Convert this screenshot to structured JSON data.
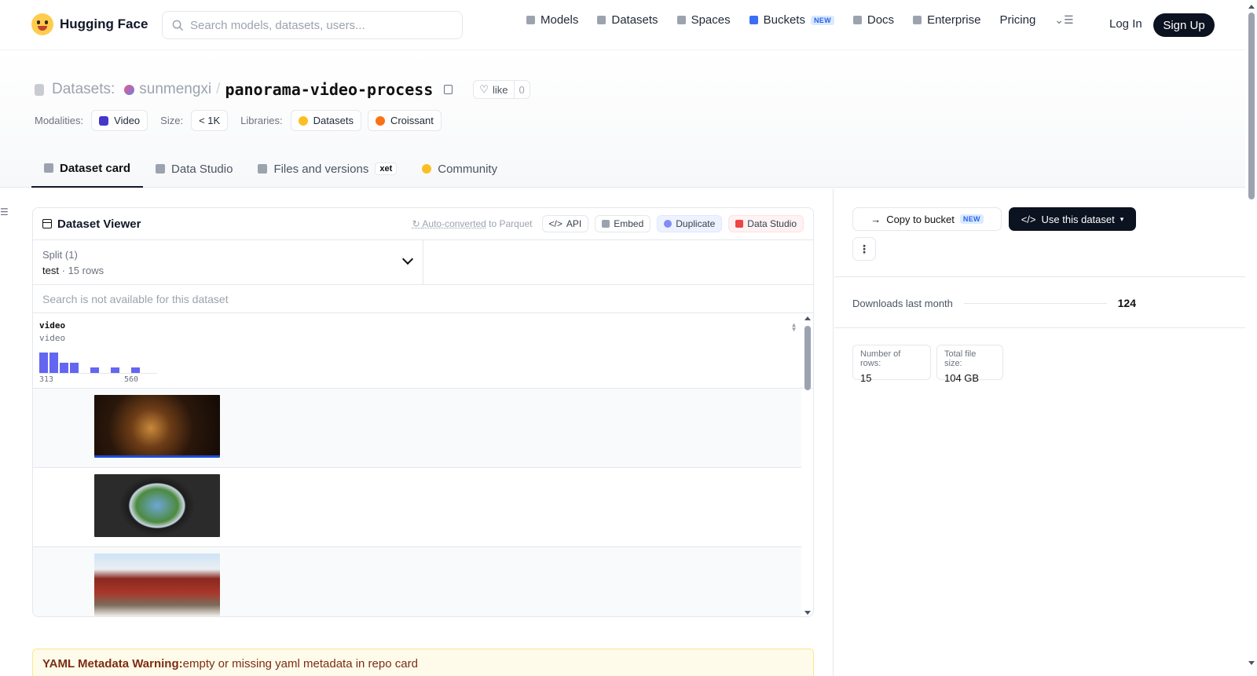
{
  "nav": {
    "brand": "Hugging Face",
    "search_placeholder": "Search models, datasets, users...",
    "links": [
      {
        "label": "Models",
        "icon": "cube-icon"
      },
      {
        "label": "Datasets",
        "icon": "database-icon"
      },
      {
        "label": "Spaces",
        "icon": "grid-icon"
      },
      {
        "label": "Buckets",
        "icon": "bucket-icon",
        "badge": "NEW"
      },
      {
        "label": "Docs",
        "icon": "book-icon"
      },
      {
        "label": "Enterprise",
        "icon": "enterprise-icon"
      },
      {
        "label": "Pricing"
      }
    ],
    "login": "Log In",
    "signup": "Sign Up"
  },
  "repo": {
    "kind_label": "Datasets:",
    "owner": "sunmengxi",
    "separator": "/",
    "name": "panorama-video-process",
    "like_label": "like",
    "like_count": "0"
  },
  "tags": {
    "modalities_label": "Modalities:",
    "modality": "Video",
    "size_label": "Size:",
    "size": "< 1K",
    "libraries_label": "Libraries:",
    "libraries": [
      "Datasets",
      "Croissant"
    ]
  },
  "tabs": [
    {
      "label": "Dataset card",
      "active": true
    },
    {
      "label": "Data Studio"
    },
    {
      "label": "Files and versions",
      "badge": "xet"
    },
    {
      "label": "Community"
    }
  ],
  "viewer": {
    "title": "Dataset Viewer",
    "auto_prefix": "Auto-converted",
    "auto_suffix": " to Parquet",
    "buttons": {
      "api": "API",
      "embed": "Embed",
      "duplicate": "Duplicate",
      "data_studio": "Data Studio"
    },
    "split_label": "Split (1)",
    "split_value": "test",
    "split_sep": "·",
    "split_rows": "15 rows",
    "search_unavailable": "Search is not available for this dataset",
    "column": {
      "name": "video",
      "type": "video",
      "hist_min": "313",
      "hist_max": "560"
    },
    "histogram": [
      1.0,
      1.0,
      0.5,
      0.5,
      0,
      0.25,
      0,
      0.25,
      0,
      0.25
    ],
    "rows": [
      "video thumbnail 1",
      "video thumbnail 2",
      "video thumbnail 3"
    ]
  },
  "yaml_warning": {
    "title": "YAML Metadata Warning:",
    "text": "empty or missing yaml metadata in repo card"
  },
  "sidebar": {
    "copy_bucket": "Copy to bucket",
    "copy_badge": "NEW",
    "use_dataset": "Use this dataset",
    "downloads_label": "Downloads last month",
    "downloads": "124",
    "rows_label": "Number of rows:",
    "rows": "15",
    "size_label": "Total file size:",
    "size": "104 GB"
  }
}
